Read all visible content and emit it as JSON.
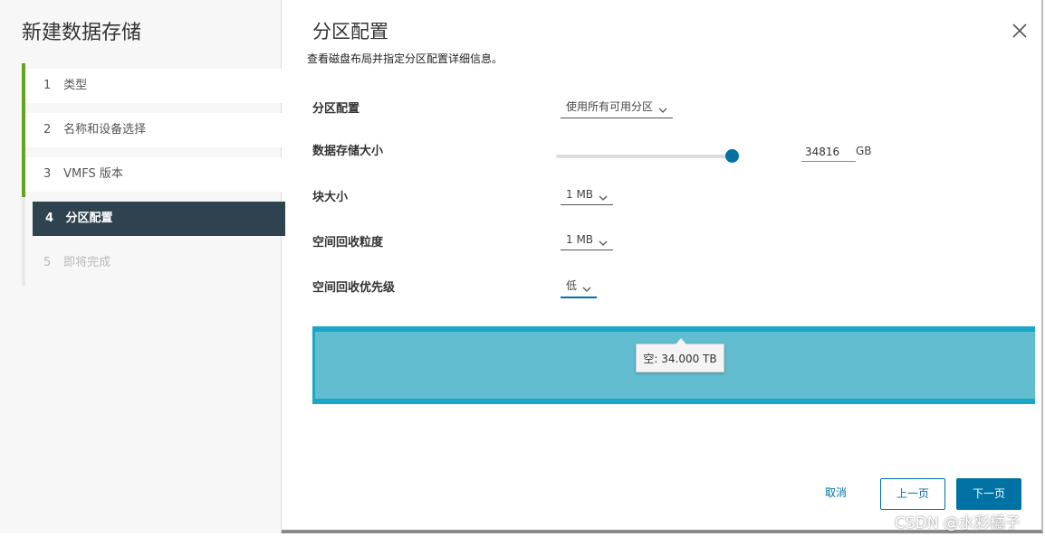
{
  "wizard": {
    "title": "新建数据存储",
    "steps": [
      {
        "num": "1",
        "label": "类型"
      },
      {
        "num": "2",
        "label": "名称和设备选择"
      },
      {
        "num": "3",
        "label": "VMFS 版本"
      },
      {
        "num": "4",
        "label": "分区配置"
      },
      {
        "num": "5",
        "label": "即将完成"
      }
    ]
  },
  "page": {
    "title": "分区配置",
    "description": "查看磁盘布局并指定分区配置详细信息。"
  },
  "form": {
    "partition_config": {
      "label": "分区配置",
      "value": "使用所有可用分区"
    },
    "datastore_size": {
      "label": "数据存储大小",
      "value": "34816",
      "unit": "GB",
      "slider_level": 1.0
    },
    "block_size": {
      "label": "块大小",
      "value": "1 MB"
    },
    "reclaim_granularity": {
      "label": "空间回收粒度",
      "value": "1 MB"
    },
    "reclaim_priority": {
      "label": "空间回收优先级",
      "value": "低"
    }
  },
  "partition_layout": {
    "tooltip": "空: 34.000 TB",
    "color": "#1aa6c7"
  },
  "buttons": {
    "cancel": "取消",
    "prev": "上一页",
    "next": "下一页"
  },
  "watermark": "CSDN @水彩橘子",
  "colors": {
    "accent": "#0072a3",
    "active_step": "#2f4250",
    "done_step": "#62a420"
  }
}
